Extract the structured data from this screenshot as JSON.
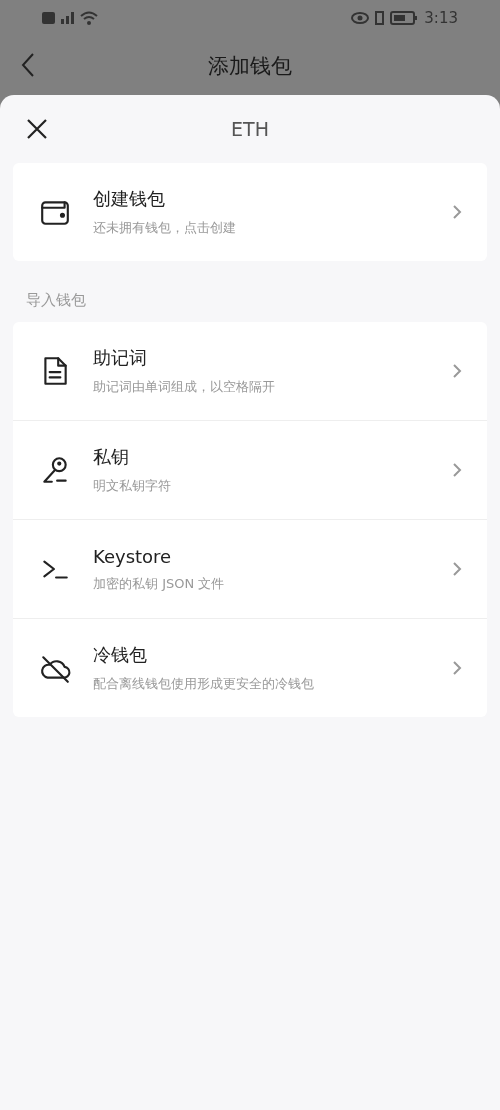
{
  "status_bar": {
    "time": "3:13"
  },
  "header": {
    "title": "添加钱包"
  },
  "sheet": {
    "title": "ETH",
    "create_group": [
      {
        "kind": "wallet",
        "title": "创建钱包",
        "subtitle": "还未拥有钱包，点击创建"
      }
    ],
    "import_label": "导入钱包",
    "import_group": [
      {
        "kind": "document",
        "title": "助记词",
        "subtitle": "助记词由单词组成，以空格隔开"
      },
      {
        "kind": "key",
        "title": "私钥",
        "subtitle": "明文私钥字符"
      },
      {
        "kind": "terminal",
        "title": "Keystore",
        "subtitle": "加密的私钥 JSON 文件"
      },
      {
        "kind": "cloud-off",
        "title": "冷钱包",
        "subtitle": "配合离线钱包使用形成更安全的冷钱包"
      }
    ]
  }
}
